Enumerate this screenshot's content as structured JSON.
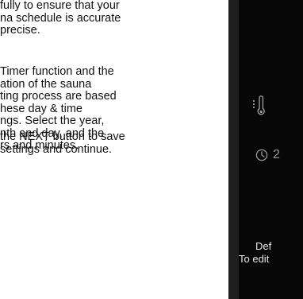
{
  "instructions": {
    "paragraph1": {
      "lines": [
        "fully to ensure that your",
        "na schedule is accurate",
        "precise."
      ]
    },
    "paragraph2": {
      "lines": [
        "Timer function and the",
        "ation of the sauna",
        "ting process are based",
        "hese day & time",
        "ngs. Select the year,",
        "nth and day, and the",
        "rs and minutes."
      ]
    },
    "paragraph3": {
      "lines": [
        "the NEXT button to save",
        "settings and continue."
      ]
    }
  },
  "device": {
    "icons": {
      "temperature": "thermometer-icon",
      "timer": "clock-icon"
    },
    "timer_value": "2",
    "footer": {
      "line1": "Def",
      "line2": "To edit"
    },
    "colors": {
      "screen_background": "#070707",
      "frame_background": "#1f1f1f",
      "icon_gray": "#9a9a9a",
      "footer_text": "#e6e6e6"
    }
  }
}
